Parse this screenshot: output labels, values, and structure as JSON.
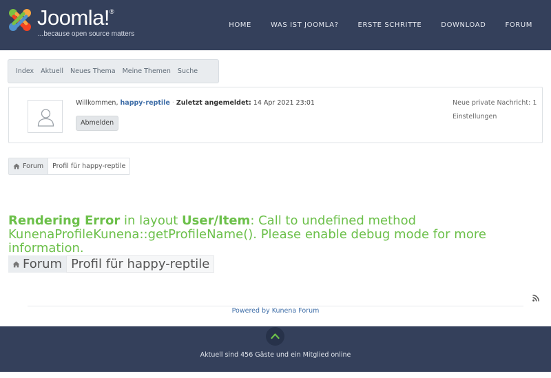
{
  "header": {
    "logo_word": "Joomla!",
    "logo_reg": "®",
    "logo_tagline": "...because open source matters",
    "nav": [
      "HOME",
      "WAS IST JOOMLA?",
      "ERSTE SCHRITTE",
      "DOWNLOAD",
      "FORUM"
    ]
  },
  "kunena_nav": [
    "Index",
    "Aktuell",
    "Neues Thema",
    "Meine Themen",
    "Suche"
  ],
  "userbox": {
    "welcome_prefix": "Willkommen,",
    "username": "happy-reptile",
    "last_login_label": "Zuletzt angemeldet:",
    "last_login_value": "14 Apr 2021 23:01",
    "logout_label": "Abmelden",
    "private_message": "Neue private Nachricht: 1",
    "settings": "Einstellungen"
  },
  "breadcrumb": {
    "home": "Forum",
    "current": "Profil für happy-reptile"
  },
  "error": {
    "title": "Rendering Error",
    "mid": "in layout",
    "layout": "User/Item",
    "message": ": Call to undefined method KunenaProfileKunena::getProfileName(). Please enable debug mode for more information."
  },
  "footer": {
    "powered_by": "Powered by Kunena Forum",
    "online": "Aktuell sind 456 Gäste und ein Mitglied online"
  },
  "colors": {
    "header_bg": "#34405b",
    "error_green": "#6cc04a",
    "link_blue": "#3f6ea8"
  },
  "icons": [
    "joomla-logo-icon",
    "user-avatar-icon",
    "home-icon",
    "rss-icon",
    "chevron-up-icon"
  ]
}
